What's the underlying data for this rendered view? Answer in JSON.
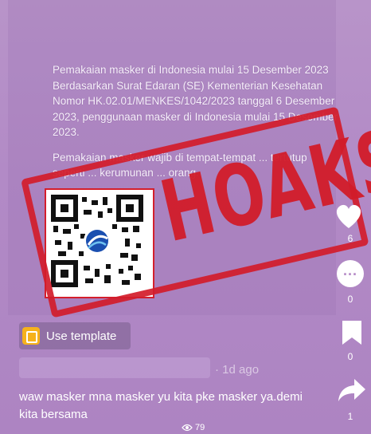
{
  "post": {
    "paragraph1": "Pemakaian masker di Indonesia mulai 15 Desember 2023 Berdasarkan Surat Edaran (SE) Kementerian Kesehatan Nomor HK.02.01/MENKES/1042/2023 tanggal 6 Desember 2023, penggunaan masker di Indonesia mulai 15 Desember 2023.",
    "paragraph2": "Pemakaian masker wajib di tempat-tempat ... tertutup seperti ... kerumunan ... orang."
  },
  "stamp": {
    "word": "HOAKS",
    "color": "#d21c2a"
  },
  "template_button": {
    "label": "Use template",
    "icon": "template-icon"
  },
  "meta": {
    "age": "· 1d ago"
  },
  "caption": {
    "text": "waw masker mna masker yu kita pke masker ya.demi kita bersama"
  },
  "views": {
    "count": "79",
    "icon": "eye-icon"
  },
  "actions": {
    "likes": "6",
    "comments": "0",
    "saves": "0",
    "shares": "1"
  },
  "colors": {
    "background": "#b58bc7",
    "accent": "#f6b21b",
    "stamp": "#d21c2a"
  }
}
